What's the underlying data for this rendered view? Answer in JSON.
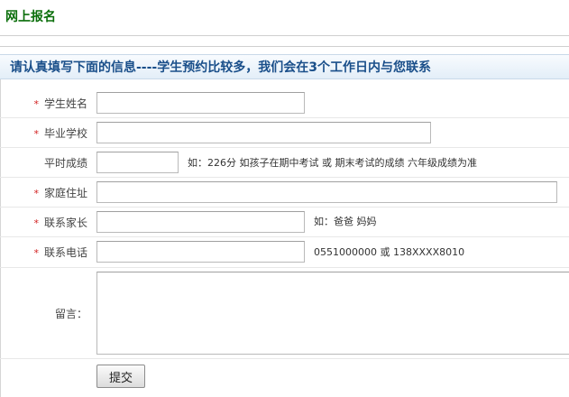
{
  "page": {
    "title": "网上报名"
  },
  "form": {
    "header": "请认真填写下面的信息----学生预约比较多，我们会在3个工作日内与您联系",
    "required_mark": "*",
    "fields": {
      "student_name": {
        "label": "学生姓名",
        "value": ""
      },
      "graduation_school": {
        "label": "毕业学校",
        "value": ""
      },
      "usual_grades": {
        "label": "平时成绩",
        "value": "",
        "hint": "如：226分 如孩子在期中考试 或 期末考试的成绩 六年级成绩为准"
      },
      "home_address": {
        "label": "家庭住址",
        "value": ""
      },
      "contact_parent": {
        "label": "联系家长",
        "value": "",
        "hint": "如：爸爸 妈妈"
      },
      "contact_phone": {
        "label": "联系电话",
        "value": "",
        "hint": "0551000000 或 138XXXX8010"
      },
      "message": {
        "label": "留言：",
        "value": ""
      }
    },
    "submit_label": "提交"
  }
}
